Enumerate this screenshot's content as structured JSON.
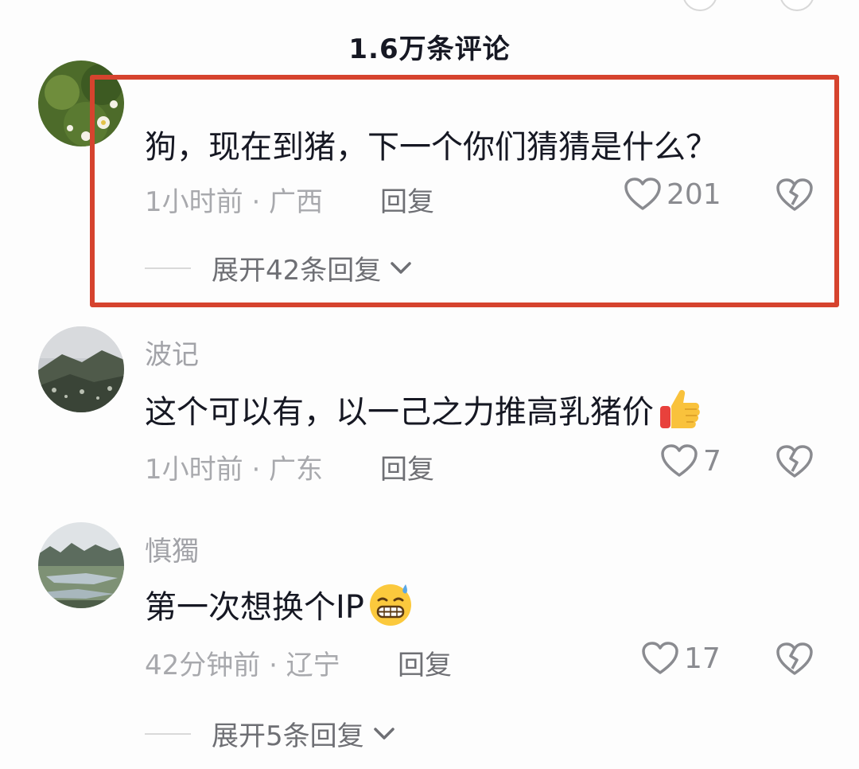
{
  "header": {
    "title": "1.6万条评论"
  },
  "comments": [
    {
      "username": "",
      "text": "狗，现在到猪，下一个你们猜猜是什么？",
      "meta": "1小时前 · 广西",
      "reply_label": "回复",
      "likes": "201",
      "expand_label": "展开42条回复",
      "avatar_icon": "flower-avatar"
    },
    {
      "username": "波记",
      "text": "这个可以有，以一己之力推高乳猪价",
      "emoji": "thumbs-up-icon",
      "meta": "1小时前 · 广东",
      "reply_label": "回复",
      "likes": "7",
      "avatar_icon": "mountain-avatar"
    },
    {
      "username": "慎獨",
      "text": "第一次想换个IP",
      "emoji": "grinning-sweat-icon",
      "meta": "42分钟前 · 辽宁",
      "reply_label": "回复",
      "likes": "17",
      "expand_label": "展开5条回复",
      "avatar_icon": "landscape-avatar"
    }
  ],
  "colors": {
    "highlight_border": "#d6432e",
    "text_primary": "#161823",
    "text_secondary": "#a8a9ad"
  }
}
